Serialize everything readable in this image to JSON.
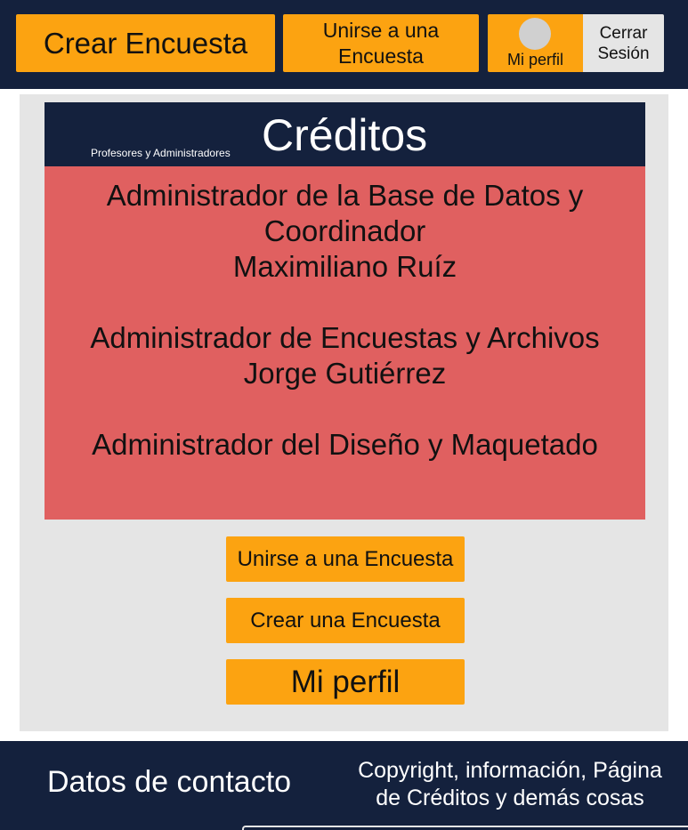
{
  "nav": {
    "create_survey": "Crear Encuesta",
    "join_survey": "Unirse a una Encuesta",
    "my_profile": "Mi perfil",
    "logout": "Cerrar Sesión"
  },
  "credits": {
    "subtitle": "Profesores y Administradores",
    "title": "Créditos",
    "entries": [
      {
        "role": "Administrador de la Base de Datos y Coordinador",
        "name": "Maximiliano Ruíz"
      },
      {
        "role": "Administrador de Encuestas y Archivos",
        "name": "Jorge Gutiérrez"
      },
      {
        "role": "Administrador del Diseño y Maquetado",
        "name": ""
      }
    ]
  },
  "actions": {
    "join": "Unirse a una Encuesta",
    "create": "Crear una Encuesta",
    "profile": "Mi perfil"
  },
  "footer": {
    "contact": "Datos de contacto",
    "copyright": "Copyright, información, Página de Créditos  y demás cosas"
  },
  "colors": {
    "navy": "#14213d",
    "orange": "#fca311",
    "panel_gray": "#e5e5e5",
    "credits_red": "#e06060"
  }
}
